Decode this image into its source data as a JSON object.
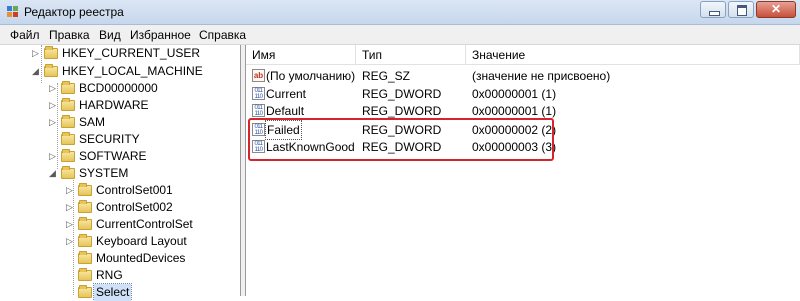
{
  "window": {
    "title": "Редактор реестра",
    "close_glyph": "✕"
  },
  "menu": [
    "Файл",
    "Правка",
    "Вид",
    "Избранное",
    "Справка"
  ],
  "tree": {
    "expand_glyph": "▷",
    "collapse_glyph": "◢",
    "nodes": [
      {
        "label": "HKEY_CURRENT_USER"
      },
      {
        "label": "HKEY_LOCAL_MACHINE"
      },
      {
        "label": "BCD00000000"
      },
      {
        "label": "HARDWARE"
      },
      {
        "label": "SAM"
      },
      {
        "label": "SECURITY"
      },
      {
        "label": "SOFTWARE"
      },
      {
        "label": "SYSTEM"
      },
      {
        "label": "ControlSet001"
      },
      {
        "label": "ControlSet002"
      },
      {
        "label": "CurrentControlSet"
      },
      {
        "label": "Keyboard Layout"
      },
      {
        "label": "MountedDevices"
      },
      {
        "label": "RNG"
      },
      {
        "label": "Select"
      }
    ],
    "selected": "Select"
  },
  "list": {
    "columns": [
      "Имя",
      "Тип",
      "Значение"
    ],
    "rows": [
      {
        "name": "(По умолчанию)",
        "type": "REG_SZ",
        "data": "(значение не присвоено)",
        "icon": "ab"
      },
      {
        "name": "Current",
        "type": "REG_DWORD",
        "data": "0x00000001 (1)",
        "icon": "011 110"
      },
      {
        "name": "Default",
        "type": "REG_DWORD",
        "data": "0x00000001 (1)",
        "icon": "011 110"
      },
      {
        "name": "Failed",
        "type": "REG_DWORD",
        "data": "0x00000002 (2)",
        "icon": "011 110"
      },
      {
        "name": "LastKnownGood",
        "type": "REG_DWORD",
        "data": "0x00000003 (3)",
        "icon": "011 110"
      }
    ]
  },
  "colors": {
    "highlight": "#d6242b",
    "selection": "#cfe0f7"
  }
}
